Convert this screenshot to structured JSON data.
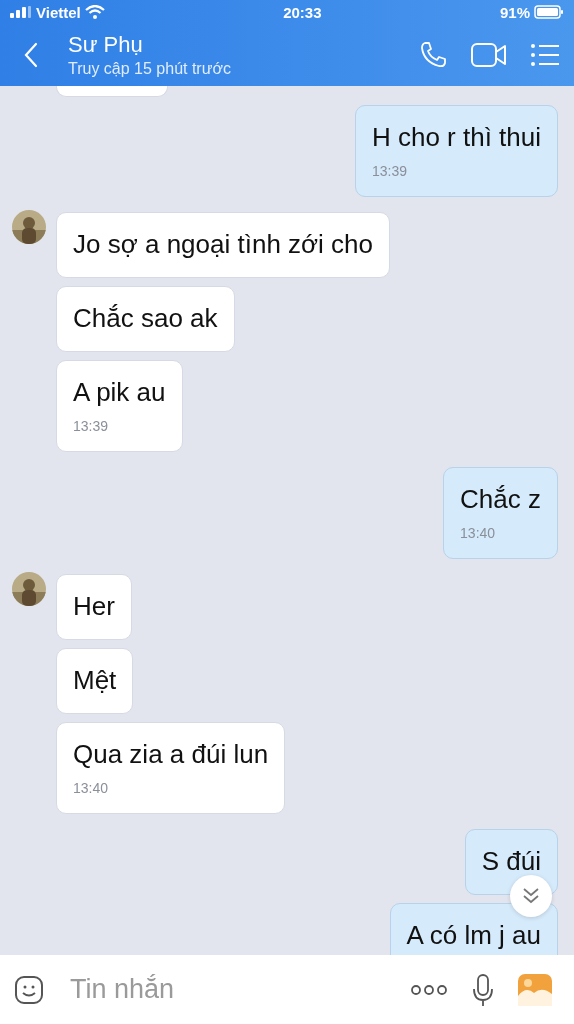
{
  "status_bar": {
    "carrier": "Viettel",
    "time": "20:33",
    "battery": "91%"
  },
  "header": {
    "title": "Sư Phụ",
    "subtitle": "Truy cập 15 phút trước"
  },
  "messages": [
    {
      "outgoing": true,
      "text": "H cho r thì thui",
      "time": "13:39",
      "avatar": false,
      "kind": "message"
    },
    {
      "outgoing": false,
      "text": "Jo sợ a ngoại tình zới cho",
      "avatar": true,
      "kind": "message"
    },
    {
      "outgoing": false,
      "text": "Chắc sao ak",
      "avatar": false,
      "kind": "message"
    },
    {
      "outgoing": false,
      "text": "A pik au",
      "time": "13:39",
      "avatar": false,
      "kind": "message"
    },
    {
      "outgoing": true,
      "text": "Chắc z",
      "time": "13:40",
      "avatar": false,
      "kind": "message"
    },
    {
      "outgoing": false,
      "text": "Her",
      "avatar": true,
      "kind": "message"
    },
    {
      "outgoing": false,
      "text": "Mệt",
      "avatar": false,
      "kind": "message"
    },
    {
      "outgoing": false,
      "text": "Qua zia a đúi lun",
      "time": "13:40",
      "avatar": false,
      "kind": "message"
    },
    {
      "outgoing": true,
      "text": "S đúi",
      "avatar": false,
      "kind": "message"
    },
    {
      "outgoing": true,
      "text": "A có lm j au",
      "avatar": false,
      "kind": "message"
    }
  ],
  "composer": {
    "placeholder": "Tin nhắn"
  }
}
